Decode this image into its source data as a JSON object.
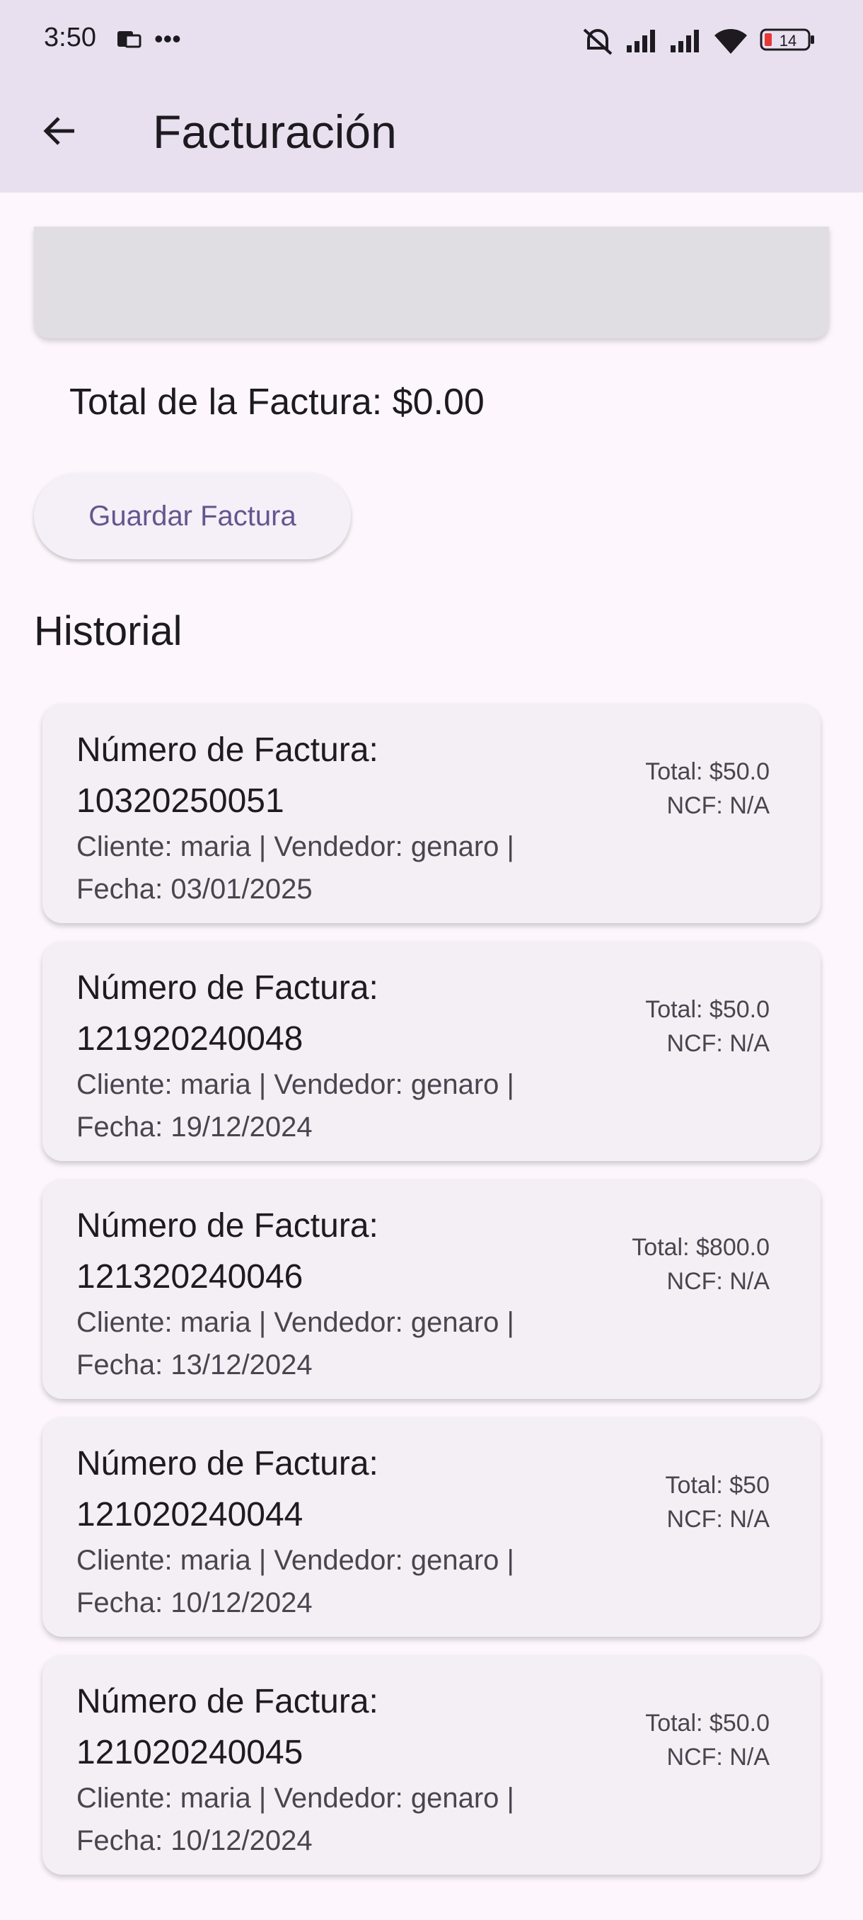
{
  "status_bar": {
    "time": "3:50",
    "battery": "14"
  },
  "app_bar": {
    "title": "Facturación",
    "back_icon": "arrow-back-icon"
  },
  "summary": {
    "total_label": "Total de la Factura: $0.00",
    "save_button": "Guardar Factura"
  },
  "history": {
    "title": "Historial",
    "invoices": [
      {
        "number_label": "Número de Factura:",
        "number": "10320250051",
        "client_line": "Cliente: maria | Vendedor: genaro |",
        "date_line": "Fecha: 03/01/2025",
        "total": "Total: $50.0",
        "ncf": "NCF: N/A"
      },
      {
        "number_label": "Número de Factura:",
        "number": "121920240048",
        "client_line": "Cliente: maria | Vendedor: genaro |",
        "date_line": "Fecha: 19/12/2024",
        "total": "Total: $50.0",
        "ncf": "NCF: N/A"
      },
      {
        "number_label": "Número de Factura:",
        "number": "121320240046",
        "client_line": "Cliente: maria | Vendedor: genaro |",
        "date_line": "Fecha: 13/12/2024",
        "total": "Total: $800.0",
        "ncf": "NCF: N/A"
      },
      {
        "number_label": "Número de Factura:",
        "number": "121020240044",
        "client_line": "Cliente: maria | Vendedor: genaro |",
        "date_line": "Fecha: 10/12/2024",
        "total": "Total: $50",
        "ncf": "NCF: N/A"
      },
      {
        "number_label": "Número de Factura:",
        "number": "121020240045",
        "client_line": "Cliente: maria | Vendedor: genaro |",
        "date_line": "Fecha: 10/12/2024",
        "total": "Total: $50.0",
        "ncf": "NCF: N/A"
      }
    ]
  }
}
